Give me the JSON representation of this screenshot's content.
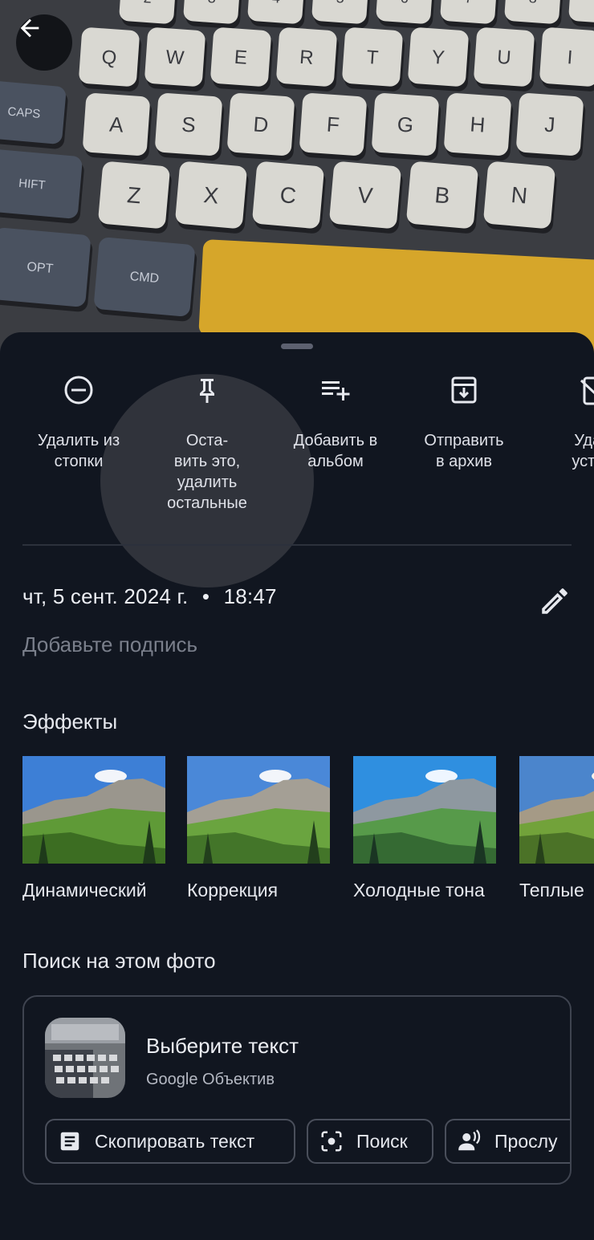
{
  "actions": [
    {
      "icon": "remove-circle-icon",
      "label": "Удалить из\nстопки"
    },
    {
      "icon": "pin-icon",
      "label": "Оста-\nвить это,\nудалить\nостальные"
    },
    {
      "icon": "playlist-add-icon",
      "label": "Добавить в\nальбом"
    },
    {
      "icon": "archive-icon",
      "label": "Отправить\nв архив"
    },
    {
      "icon": "delete-device-icon",
      "label": "Удал\nустро"
    }
  ],
  "info": {
    "date": "чт, 5 сент. 2024 г.",
    "separator": "•",
    "time": "18:47",
    "caption_placeholder": "Добавьте подпись"
  },
  "effects": {
    "title": "Эффекты",
    "items": [
      "Динамический",
      "Коррекция",
      "Холодные тона",
      "Теплые"
    ]
  },
  "lens": {
    "section_title": "Поиск на этом фото",
    "title": "Выберите текст",
    "subtitle": "Google Объектив",
    "chips": [
      "Скопировать текст",
      "Поиск",
      "Прослу"
    ]
  },
  "keyboard": {
    "row_numbers": [
      "2",
      "3",
      "4",
      "5",
      "6",
      "7",
      "8",
      "("
    ],
    "row_numbers_top": [
      "@",
      "#",
      "$",
      "%",
      "^",
      "&",
      "*",
      "("
    ],
    "row_q": [
      "Q",
      "W",
      "E",
      "R",
      "T",
      "Y",
      "U",
      "I"
    ],
    "row_a": [
      "A",
      "S",
      "D",
      "F",
      "G",
      "H",
      "J"
    ],
    "row_z": [
      "Z",
      "X",
      "C",
      "V",
      "B",
      "N"
    ],
    "mods": [
      "CAPS",
      "HIFT",
      "OPT",
      "CMD"
    ]
  },
  "colors": {
    "sheet_bg": "#111620",
    "accent_yellow": "#d6a62a"
  }
}
